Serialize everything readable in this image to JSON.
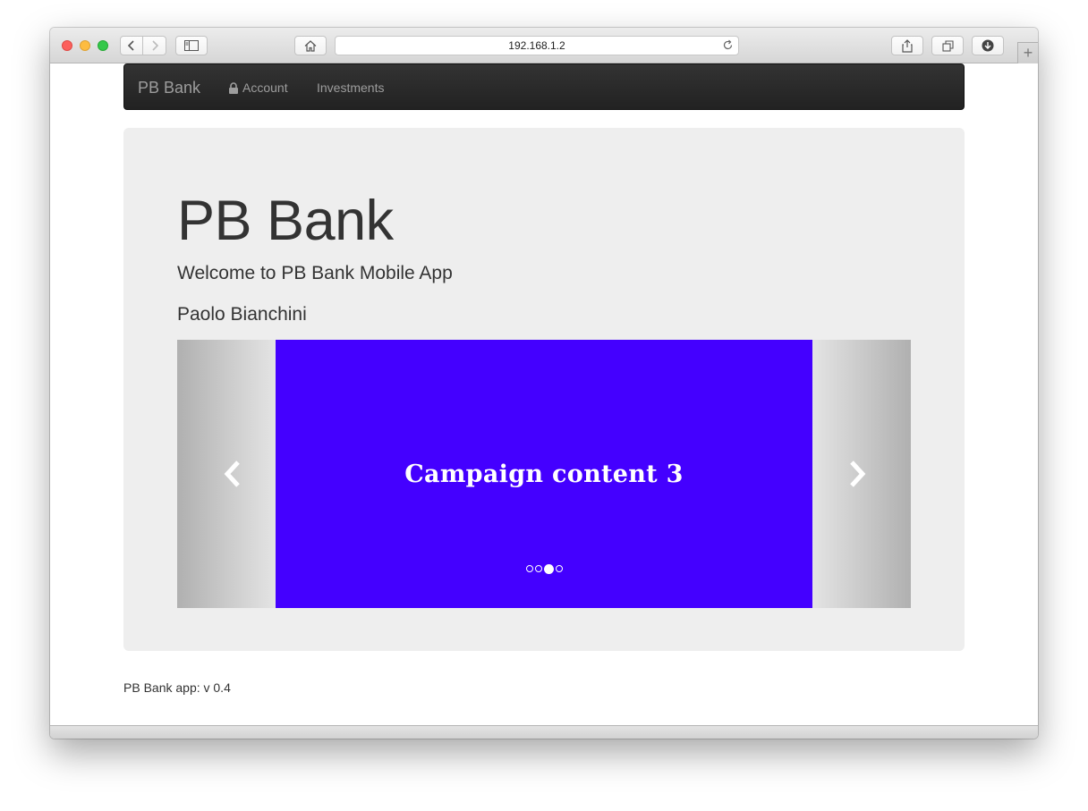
{
  "browser": {
    "url": "192.168.1.2",
    "icons": [
      "back-icon",
      "forward-icon",
      "sidebar-icon",
      "home-icon",
      "reload-icon",
      "share-icon",
      "tabs-icon",
      "download-icon",
      "new-tab-icon"
    ],
    "new_tab_glyph": "+"
  },
  "navbar": {
    "brand": "PB Bank",
    "items": [
      {
        "label": "Account",
        "icon": "lock-icon"
      },
      {
        "label": "Investments"
      }
    ]
  },
  "jumbotron": {
    "title": "PB Bank",
    "welcome": "Welcome to PB Bank Mobile App",
    "user": "Paolo Bianchini"
  },
  "carousel": {
    "slide_text": "Campaign content 3",
    "slide_color": "#4400ff",
    "active_index": 3,
    "total_slides": 4
  },
  "footer": {
    "version_text": "PB Bank app: v 0.4"
  }
}
